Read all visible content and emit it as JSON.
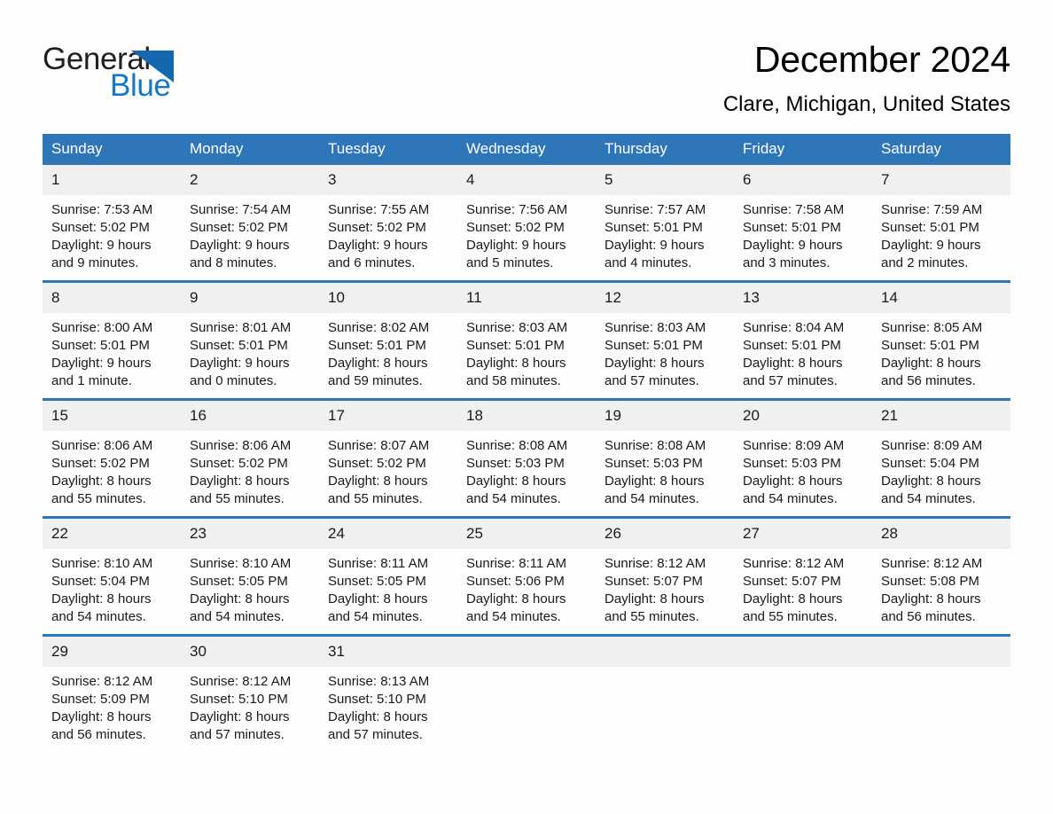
{
  "brand": {
    "name_part1": "General",
    "name_part2": "Blue",
    "logo_icon": "triangle-logo-icon",
    "accent_color": "#1777c4",
    "dark_color": "#1568ad"
  },
  "header": {
    "title": "December 2024",
    "subtitle": "Clare, Michigan, United States"
  },
  "theme": {
    "header_blue": "#2e76b8",
    "daynum_gray": "#f0f0f0",
    "text_color": "#1a1a1a"
  },
  "weekday_headers": [
    "Sunday",
    "Monday",
    "Tuesday",
    "Wednesday",
    "Thursday",
    "Friday",
    "Saturday"
  ],
  "weeks": [
    [
      {
        "day": "1",
        "sunrise": "Sunrise: 7:53 AM",
        "sunset": "Sunset: 5:02 PM",
        "daylight_line1": "Daylight: 9 hours",
        "daylight_line2": "and 9 minutes."
      },
      {
        "day": "2",
        "sunrise": "Sunrise: 7:54 AM",
        "sunset": "Sunset: 5:02 PM",
        "daylight_line1": "Daylight: 9 hours",
        "daylight_line2": "and 8 minutes."
      },
      {
        "day": "3",
        "sunrise": "Sunrise: 7:55 AM",
        "sunset": "Sunset: 5:02 PM",
        "daylight_line1": "Daylight: 9 hours",
        "daylight_line2": "and 6 minutes."
      },
      {
        "day": "4",
        "sunrise": "Sunrise: 7:56 AM",
        "sunset": "Sunset: 5:02 PM",
        "daylight_line1": "Daylight: 9 hours",
        "daylight_line2": "and 5 minutes."
      },
      {
        "day": "5",
        "sunrise": "Sunrise: 7:57 AM",
        "sunset": "Sunset: 5:01 PM",
        "daylight_line1": "Daylight: 9 hours",
        "daylight_line2": "and 4 minutes."
      },
      {
        "day": "6",
        "sunrise": "Sunrise: 7:58 AM",
        "sunset": "Sunset: 5:01 PM",
        "daylight_line1": "Daylight: 9 hours",
        "daylight_line2": "and 3 minutes."
      },
      {
        "day": "7",
        "sunrise": "Sunrise: 7:59 AM",
        "sunset": "Sunset: 5:01 PM",
        "daylight_line1": "Daylight: 9 hours",
        "daylight_line2": "and 2 minutes."
      }
    ],
    [
      {
        "day": "8",
        "sunrise": "Sunrise: 8:00 AM",
        "sunset": "Sunset: 5:01 PM",
        "daylight_line1": "Daylight: 9 hours",
        "daylight_line2": "and 1 minute."
      },
      {
        "day": "9",
        "sunrise": "Sunrise: 8:01 AM",
        "sunset": "Sunset: 5:01 PM",
        "daylight_line1": "Daylight: 9 hours",
        "daylight_line2": "and 0 minutes."
      },
      {
        "day": "10",
        "sunrise": "Sunrise: 8:02 AM",
        "sunset": "Sunset: 5:01 PM",
        "daylight_line1": "Daylight: 8 hours",
        "daylight_line2": "and 59 minutes."
      },
      {
        "day": "11",
        "sunrise": "Sunrise: 8:03 AM",
        "sunset": "Sunset: 5:01 PM",
        "daylight_line1": "Daylight: 8 hours",
        "daylight_line2": "and 58 minutes."
      },
      {
        "day": "12",
        "sunrise": "Sunrise: 8:03 AM",
        "sunset": "Sunset: 5:01 PM",
        "daylight_line1": "Daylight: 8 hours",
        "daylight_line2": "and 57 minutes."
      },
      {
        "day": "13",
        "sunrise": "Sunrise: 8:04 AM",
        "sunset": "Sunset: 5:01 PM",
        "daylight_line1": "Daylight: 8 hours",
        "daylight_line2": "and 57 minutes."
      },
      {
        "day": "14",
        "sunrise": "Sunrise: 8:05 AM",
        "sunset": "Sunset: 5:01 PM",
        "daylight_line1": "Daylight: 8 hours",
        "daylight_line2": "and 56 minutes."
      }
    ],
    [
      {
        "day": "15",
        "sunrise": "Sunrise: 8:06 AM",
        "sunset": "Sunset: 5:02 PM",
        "daylight_line1": "Daylight: 8 hours",
        "daylight_line2": "and 55 minutes."
      },
      {
        "day": "16",
        "sunrise": "Sunrise: 8:06 AM",
        "sunset": "Sunset: 5:02 PM",
        "daylight_line1": "Daylight: 8 hours",
        "daylight_line2": "and 55 minutes."
      },
      {
        "day": "17",
        "sunrise": "Sunrise: 8:07 AM",
        "sunset": "Sunset: 5:02 PM",
        "daylight_line1": "Daylight: 8 hours",
        "daylight_line2": "and 55 minutes."
      },
      {
        "day": "18",
        "sunrise": "Sunrise: 8:08 AM",
        "sunset": "Sunset: 5:03 PM",
        "daylight_line1": "Daylight: 8 hours",
        "daylight_line2": "and 54 minutes."
      },
      {
        "day": "19",
        "sunrise": "Sunrise: 8:08 AM",
        "sunset": "Sunset: 5:03 PM",
        "daylight_line1": "Daylight: 8 hours",
        "daylight_line2": "and 54 minutes."
      },
      {
        "day": "20",
        "sunrise": "Sunrise: 8:09 AM",
        "sunset": "Sunset: 5:03 PM",
        "daylight_line1": "Daylight: 8 hours",
        "daylight_line2": "and 54 minutes."
      },
      {
        "day": "21",
        "sunrise": "Sunrise: 8:09 AM",
        "sunset": "Sunset: 5:04 PM",
        "daylight_line1": "Daylight: 8 hours",
        "daylight_line2": "and 54 minutes."
      }
    ],
    [
      {
        "day": "22",
        "sunrise": "Sunrise: 8:10 AM",
        "sunset": "Sunset: 5:04 PM",
        "daylight_line1": "Daylight: 8 hours",
        "daylight_line2": "and 54 minutes."
      },
      {
        "day": "23",
        "sunrise": "Sunrise: 8:10 AM",
        "sunset": "Sunset: 5:05 PM",
        "daylight_line1": "Daylight: 8 hours",
        "daylight_line2": "and 54 minutes."
      },
      {
        "day": "24",
        "sunrise": "Sunrise: 8:11 AM",
        "sunset": "Sunset: 5:05 PM",
        "daylight_line1": "Daylight: 8 hours",
        "daylight_line2": "and 54 minutes."
      },
      {
        "day": "25",
        "sunrise": "Sunrise: 8:11 AM",
        "sunset": "Sunset: 5:06 PM",
        "daylight_line1": "Daylight: 8 hours",
        "daylight_line2": "and 54 minutes."
      },
      {
        "day": "26",
        "sunrise": "Sunrise: 8:12 AM",
        "sunset": "Sunset: 5:07 PM",
        "daylight_line1": "Daylight: 8 hours",
        "daylight_line2": "and 55 minutes."
      },
      {
        "day": "27",
        "sunrise": "Sunrise: 8:12 AM",
        "sunset": "Sunset: 5:07 PM",
        "daylight_line1": "Daylight: 8 hours",
        "daylight_line2": "and 55 minutes."
      },
      {
        "day": "28",
        "sunrise": "Sunrise: 8:12 AM",
        "sunset": "Sunset: 5:08 PM",
        "daylight_line1": "Daylight: 8 hours",
        "daylight_line2": "and 56 minutes."
      }
    ],
    [
      {
        "day": "29",
        "sunrise": "Sunrise: 8:12 AM",
        "sunset": "Sunset: 5:09 PM",
        "daylight_line1": "Daylight: 8 hours",
        "daylight_line2": "and 56 minutes."
      },
      {
        "day": "30",
        "sunrise": "Sunrise: 8:12 AM",
        "sunset": "Sunset: 5:10 PM",
        "daylight_line1": "Daylight: 8 hours",
        "daylight_line2": "and 57 minutes."
      },
      {
        "day": "31",
        "sunrise": "Sunrise: 8:13 AM",
        "sunset": "Sunset: 5:10 PM",
        "daylight_line1": "Daylight: 8 hours",
        "daylight_line2": "and 57 minutes."
      },
      {
        "day": "",
        "sunrise": "",
        "sunset": "",
        "daylight_line1": "",
        "daylight_line2": ""
      },
      {
        "day": "",
        "sunrise": "",
        "sunset": "",
        "daylight_line1": "",
        "daylight_line2": ""
      },
      {
        "day": "",
        "sunrise": "",
        "sunset": "",
        "daylight_line1": "",
        "daylight_line2": ""
      },
      {
        "day": "",
        "sunrise": "",
        "sunset": "",
        "daylight_line1": "",
        "daylight_line2": ""
      }
    ]
  ]
}
